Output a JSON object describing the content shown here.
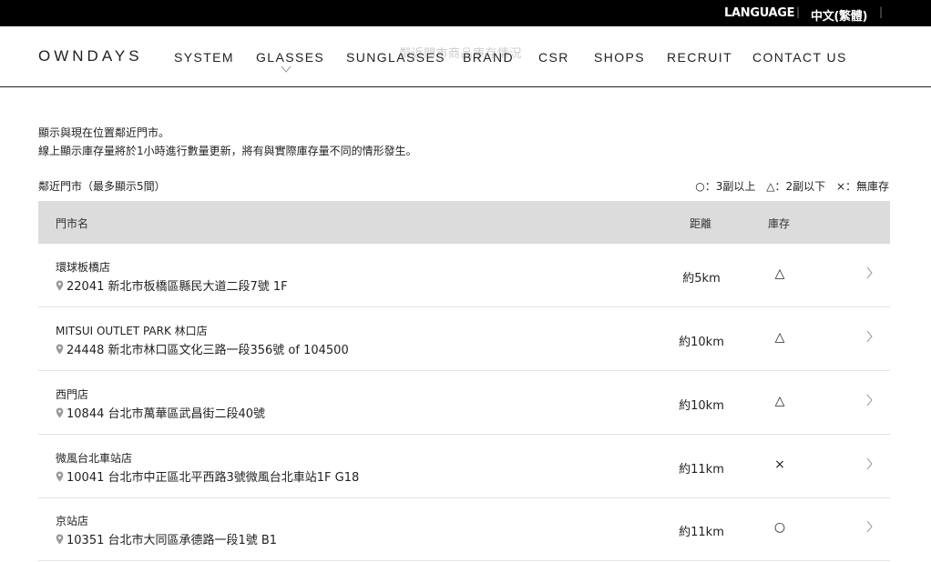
{
  "topbar": {
    "language_label": "LANGUAGE",
    "current_language": "中文(繁體)"
  },
  "header": {
    "logo": "OWNDAYS",
    "nav": [
      "SYSTEM",
      "GLASSES",
      "SUNGLASSES",
      "BRAND",
      "CSR",
      "SHOPS",
      "RECRUIT",
      "CONTACT US"
    ],
    "overlay_title": "鄰近門市商品庫存情況"
  },
  "intro": {
    "line1": "顯示與現在位置鄰近門市。",
    "line2": "線上顯示庫存量將於1小時進行數量更新，將有與實際庫存量不同的情形發生。"
  },
  "section": {
    "label": "鄰近門市（最多顯示5間）",
    "legend": [
      "○：3副以上",
      "△：2副以下",
      "×：無庫存"
    ]
  },
  "table": {
    "headers": {
      "store": "門市名",
      "distance": "距離",
      "stock": "庫存"
    },
    "rows": [
      {
        "name": "環球板橋店",
        "address": "22041 新北市板橋區縣民大道二段7號 1F",
        "distance": "約5km",
        "stock": "△"
      },
      {
        "name": "MITSUI OUTLET PARK 林口店",
        "address": "24448 新北市林口區文化三路一段356號 of 104500",
        "distance": "約10km",
        "stock": "△"
      },
      {
        "name": "西門店",
        "address": "10844 台北市萬華區武昌街二段40號",
        "distance": "約10km",
        "stock": "△"
      },
      {
        "name": "微風台北車站店",
        "address": "10041 台北市中正區北平西路3號微風台北車站1F G18",
        "distance": "約11km",
        "stock": "×"
      },
      {
        "name": "京站店",
        "address": "10351 台北市大同區承德路一段1號 B1",
        "distance": "約11km",
        "stock": "○"
      }
    ]
  },
  "colors": {
    "topbar_bg": "#000000",
    "table_header_bg": "#dcdcdc",
    "row_divider": "#e3e3e3",
    "pin_color": "#999999",
    "chevron_color": "#999999"
  }
}
